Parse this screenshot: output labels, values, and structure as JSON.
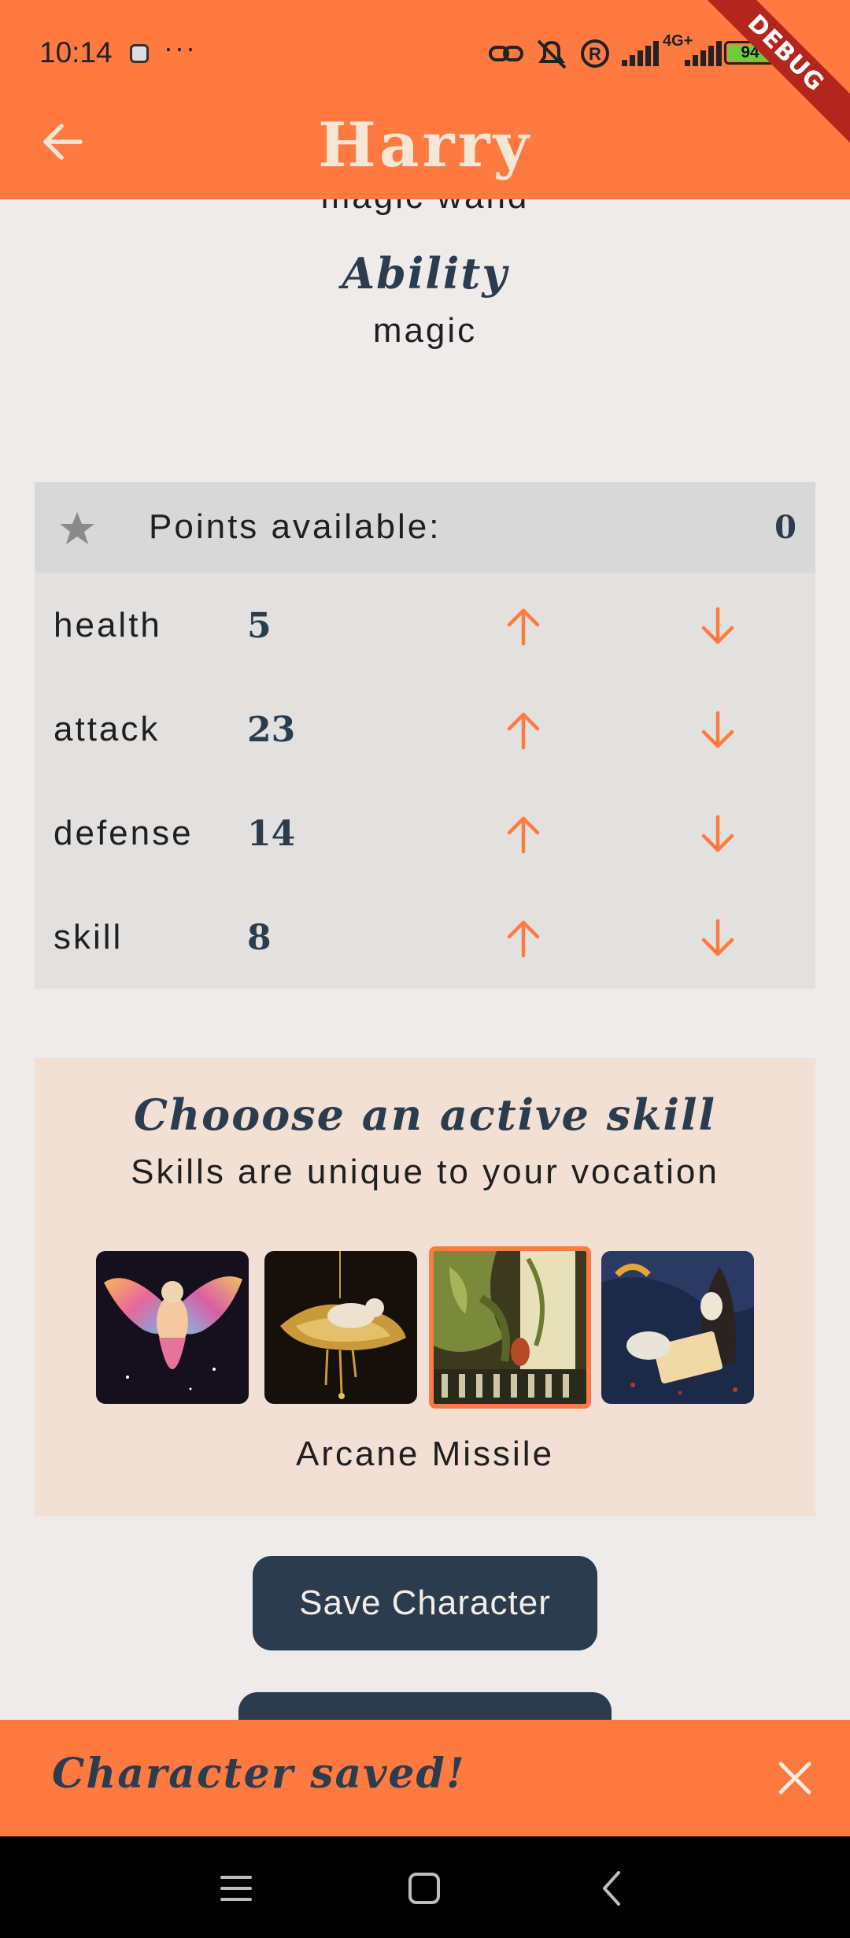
{
  "status_bar": {
    "time": "10:14",
    "overflow": "···",
    "network": "4G+",
    "battery_level": "94"
  },
  "debug_banner": "DEBUG",
  "app_bar": {
    "title": "Harry",
    "back_icon": "arrow-left-icon"
  },
  "character": {
    "weapon": "magic wand",
    "ability_heading": "Ability",
    "ability_value": "magic"
  },
  "stats": {
    "points_label": "Points available:",
    "points_value": "0",
    "rows": [
      {
        "name": "health",
        "value": "5"
      },
      {
        "name": "attack",
        "value": "23"
      },
      {
        "name": "defense",
        "value": "14"
      },
      {
        "name": "skill",
        "value": "8"
      }
    ]
  },
  "skills": {
    "title": "Chooose an active skill",
    "subtitle": "Skills are unique to your vocation",
    "selected_index": 2,
    "selected_name": "Arcane Missile"
  },
  "actions": {
    "save_label": "Save Character"
  },
  "snackbar": {
    "message": "Character saved!"
  },
  "colors": {
    "accent": "#ff7a40",
    "navy": "#2b3c4e",
    "background": "#efebea"
  }
}
